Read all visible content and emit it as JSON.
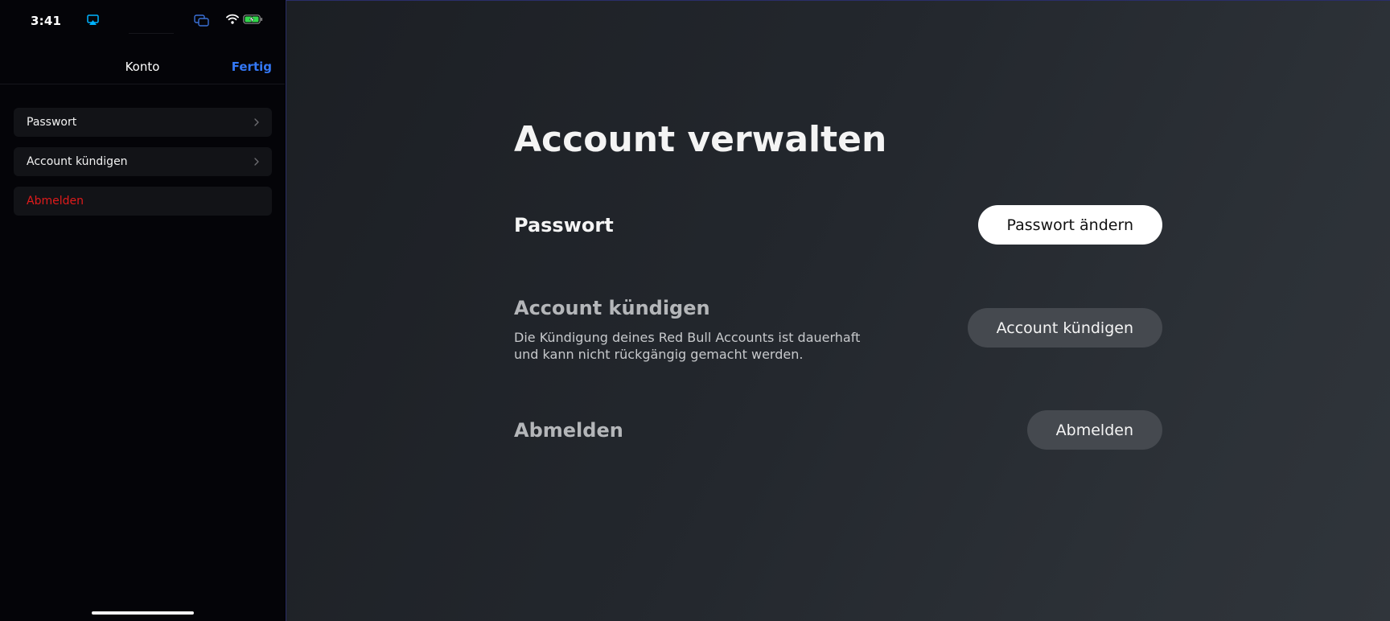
{
  "phone": {
    "status_bar": {
      "time": "3:41",
      "icons": [
        "airplay-icon",
        "screen-mirroring-icon",
        "wifi-icon",
        "battery-charging-icon"
      ],
      "airplay_color": "#00b3ff",
      "battery_color": "#32d74b"
    },
    "nav": {
      "title": "Konto",
      "done_label": "Fertig",
      "done_color": "#3478f6"
    },
    "menu_items": [
      {
        "label": "Passwort",
        "has_chevron": true
      },
      {
        "label": "Account kündigen",
        "has_chevron": true
      },
      {
        "label": "Abmelden",
        "has_chevron": false,
        "destructive": true,
        "color": "#e01b1b"
      }
    ]
  },
  "tv": {
    "page_title": "Account verwalten",
    "sections": [
      {
        "title": "Passwort",
        "button_label": "Passwort ändern",
        "focused": true
      },
      {
        "title": "Account kündigen",
        "description": "Die Kündigung deines Red Bull Accounts ist dauerhaft und kann nicht rückgängig gemacht werden.",
        "button_label": "Account kündigen",
        "focused": false
      },
      {
        "title": "Abmelden",
        "button_label": "Abmelden",
        "focused": false
      }
    ]
  }
}
